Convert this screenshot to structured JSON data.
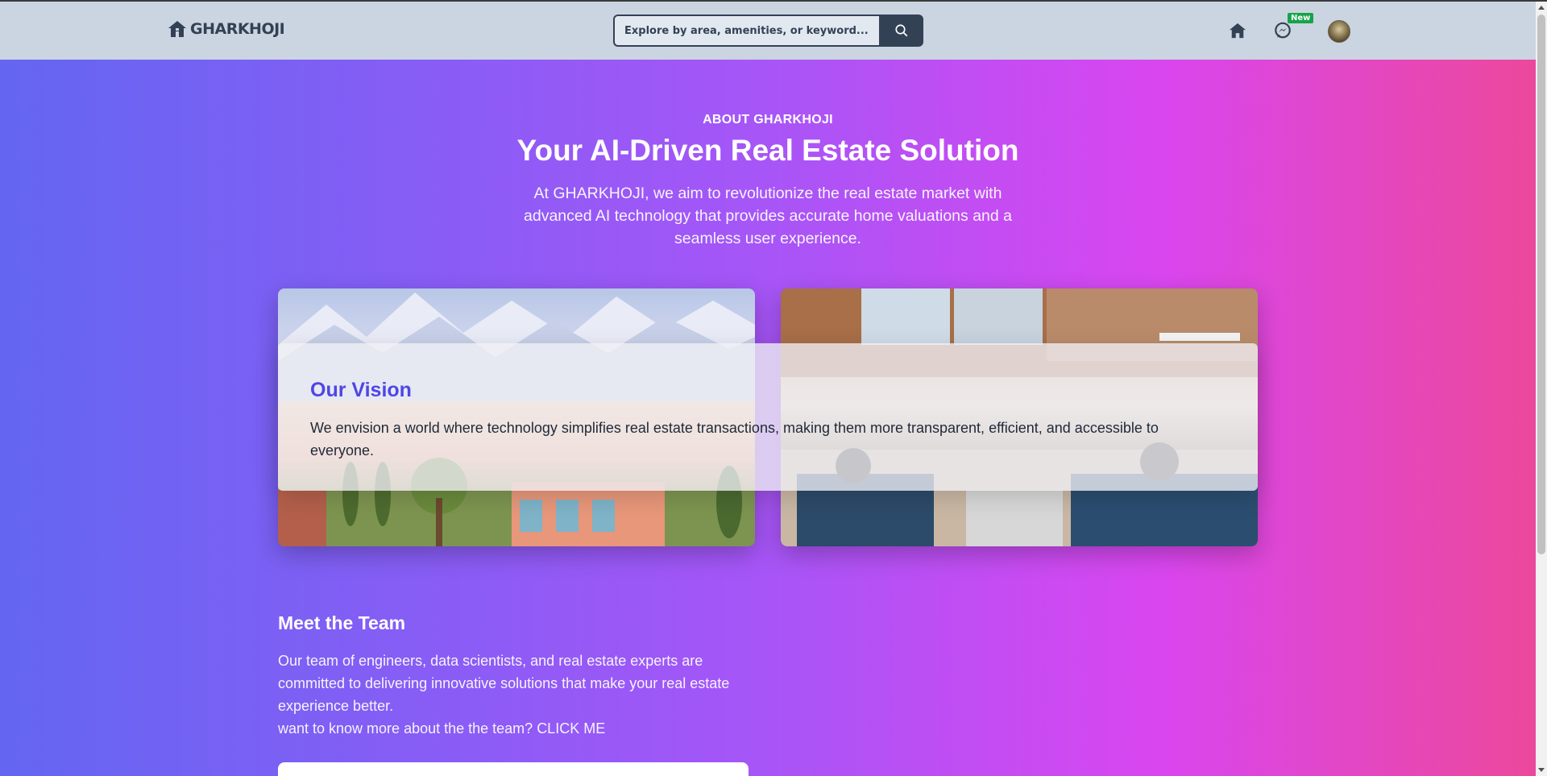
{
  "navbar": {
    "brand": "GHARKHOJI",
    "search_placeholder": "Explore by area, amenities, or keyword...",
    "new_badge": "New"
  },
  "hero": {
    "eyebrow": "ABOUT GHARKHOJI",
    "title": "Your AI-Driven Real Estate Solution",
    "description": "At GHARKHOJI, we aim to revolutionize the real estate market with advanced AI technology that provides accurate home valuations and a seamless user experience."
  },
  "vision": {
    "title": "Our Vision",
    "text": "We envision a world where technology simplifies real estate transactions, making them more transparent, efficient, and accessible to everyone."
  },
  "team": {
    "title": "Meet the Team",
    "description": "Our team of engineers, data scientists, and real estate experts are committed to delivering innovative solutions that make your real estate experience better.",
    "link_text": "want to know more about the the team? CLICK ME"
  },
  "colors": {
    "navbar_bg": "#cbd5e1",
    "accent": "#4f46e5",
    "gradient_start": "#6366f1",
    "gradient_end": "#ec4899",
    "badge": "#16a34a"
  },
  "icons": [
    "house-icon",
    "search-icon",
    "home-icon",
    "messenger-icon"
  ]
}
